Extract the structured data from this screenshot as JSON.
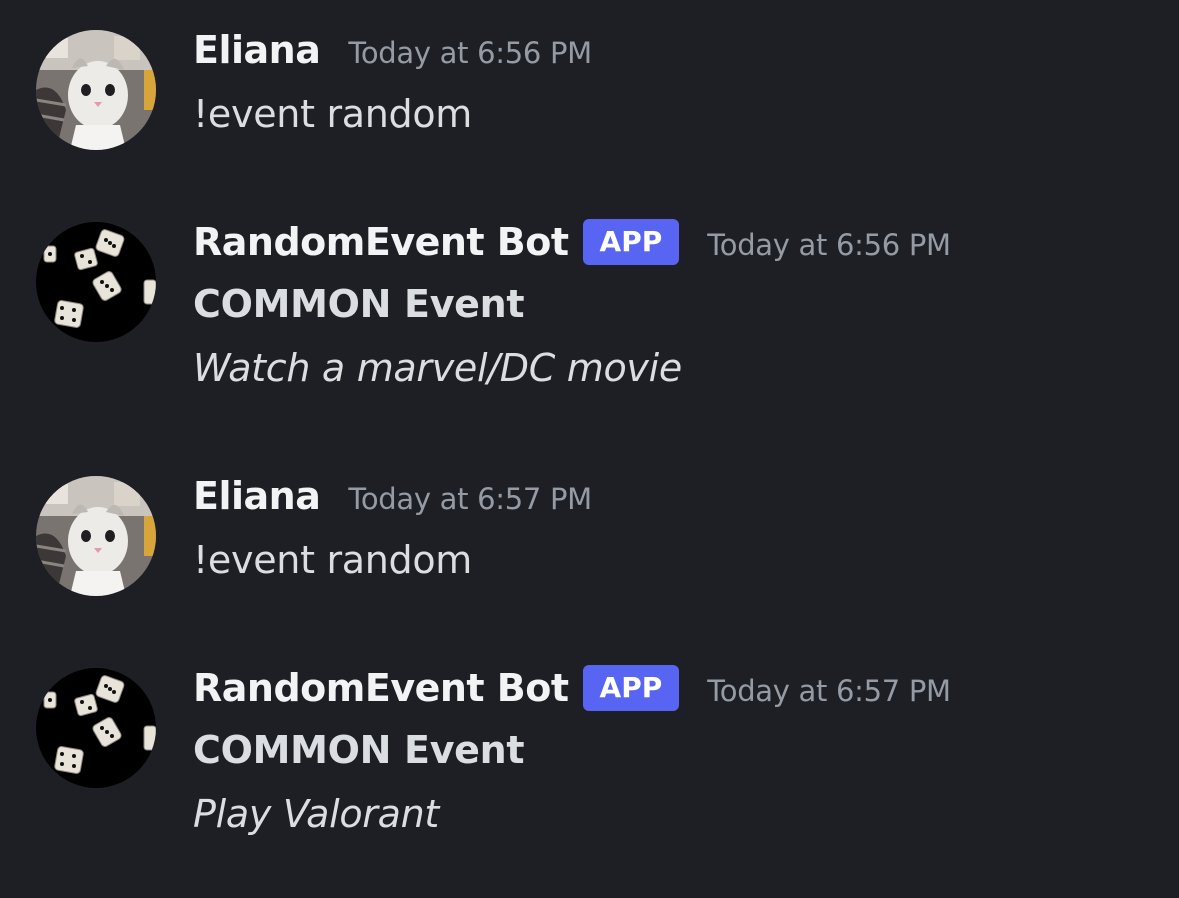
{
  "messages": [
    {
      "author": "Eliana",
      "avatar_icon": "cat-avatar",
      "timestamp": "Today at 6:56 PM",
      "content": "!event random"
    },
    {
      "author": "RandomEvent Bot",
      "badge": "APP",
      "avatar_icon": "dice-avatar",
      "timestamp": "Today at 6:56 PM",
      "title": "COMMON Event",
      "content": "Watch a marvel/DC movie"
    },
    {
      "author": "Eliana",
      "avatar_icon": "cat-avatar",
      "timestamp": "Today at 6:57 PM",
      "content": "!event random"
    },
    {
      "author": "RandomEvent Bot",
      "badge": "APP",
      "avatar_icon": "dice-avatar",
      "timestamp": "Today at 6:57 PM",
      "title": "COMMON Event",
      "content": "Play Valorant"
    }
  ],
  "colors": {
    "background": "#1e1f24",
    "author": "#f2f3f5",
    "timestamp": "#949ba4",
    "text": "#dbdee1",
    "badge": "#5865f2"
  }
}
